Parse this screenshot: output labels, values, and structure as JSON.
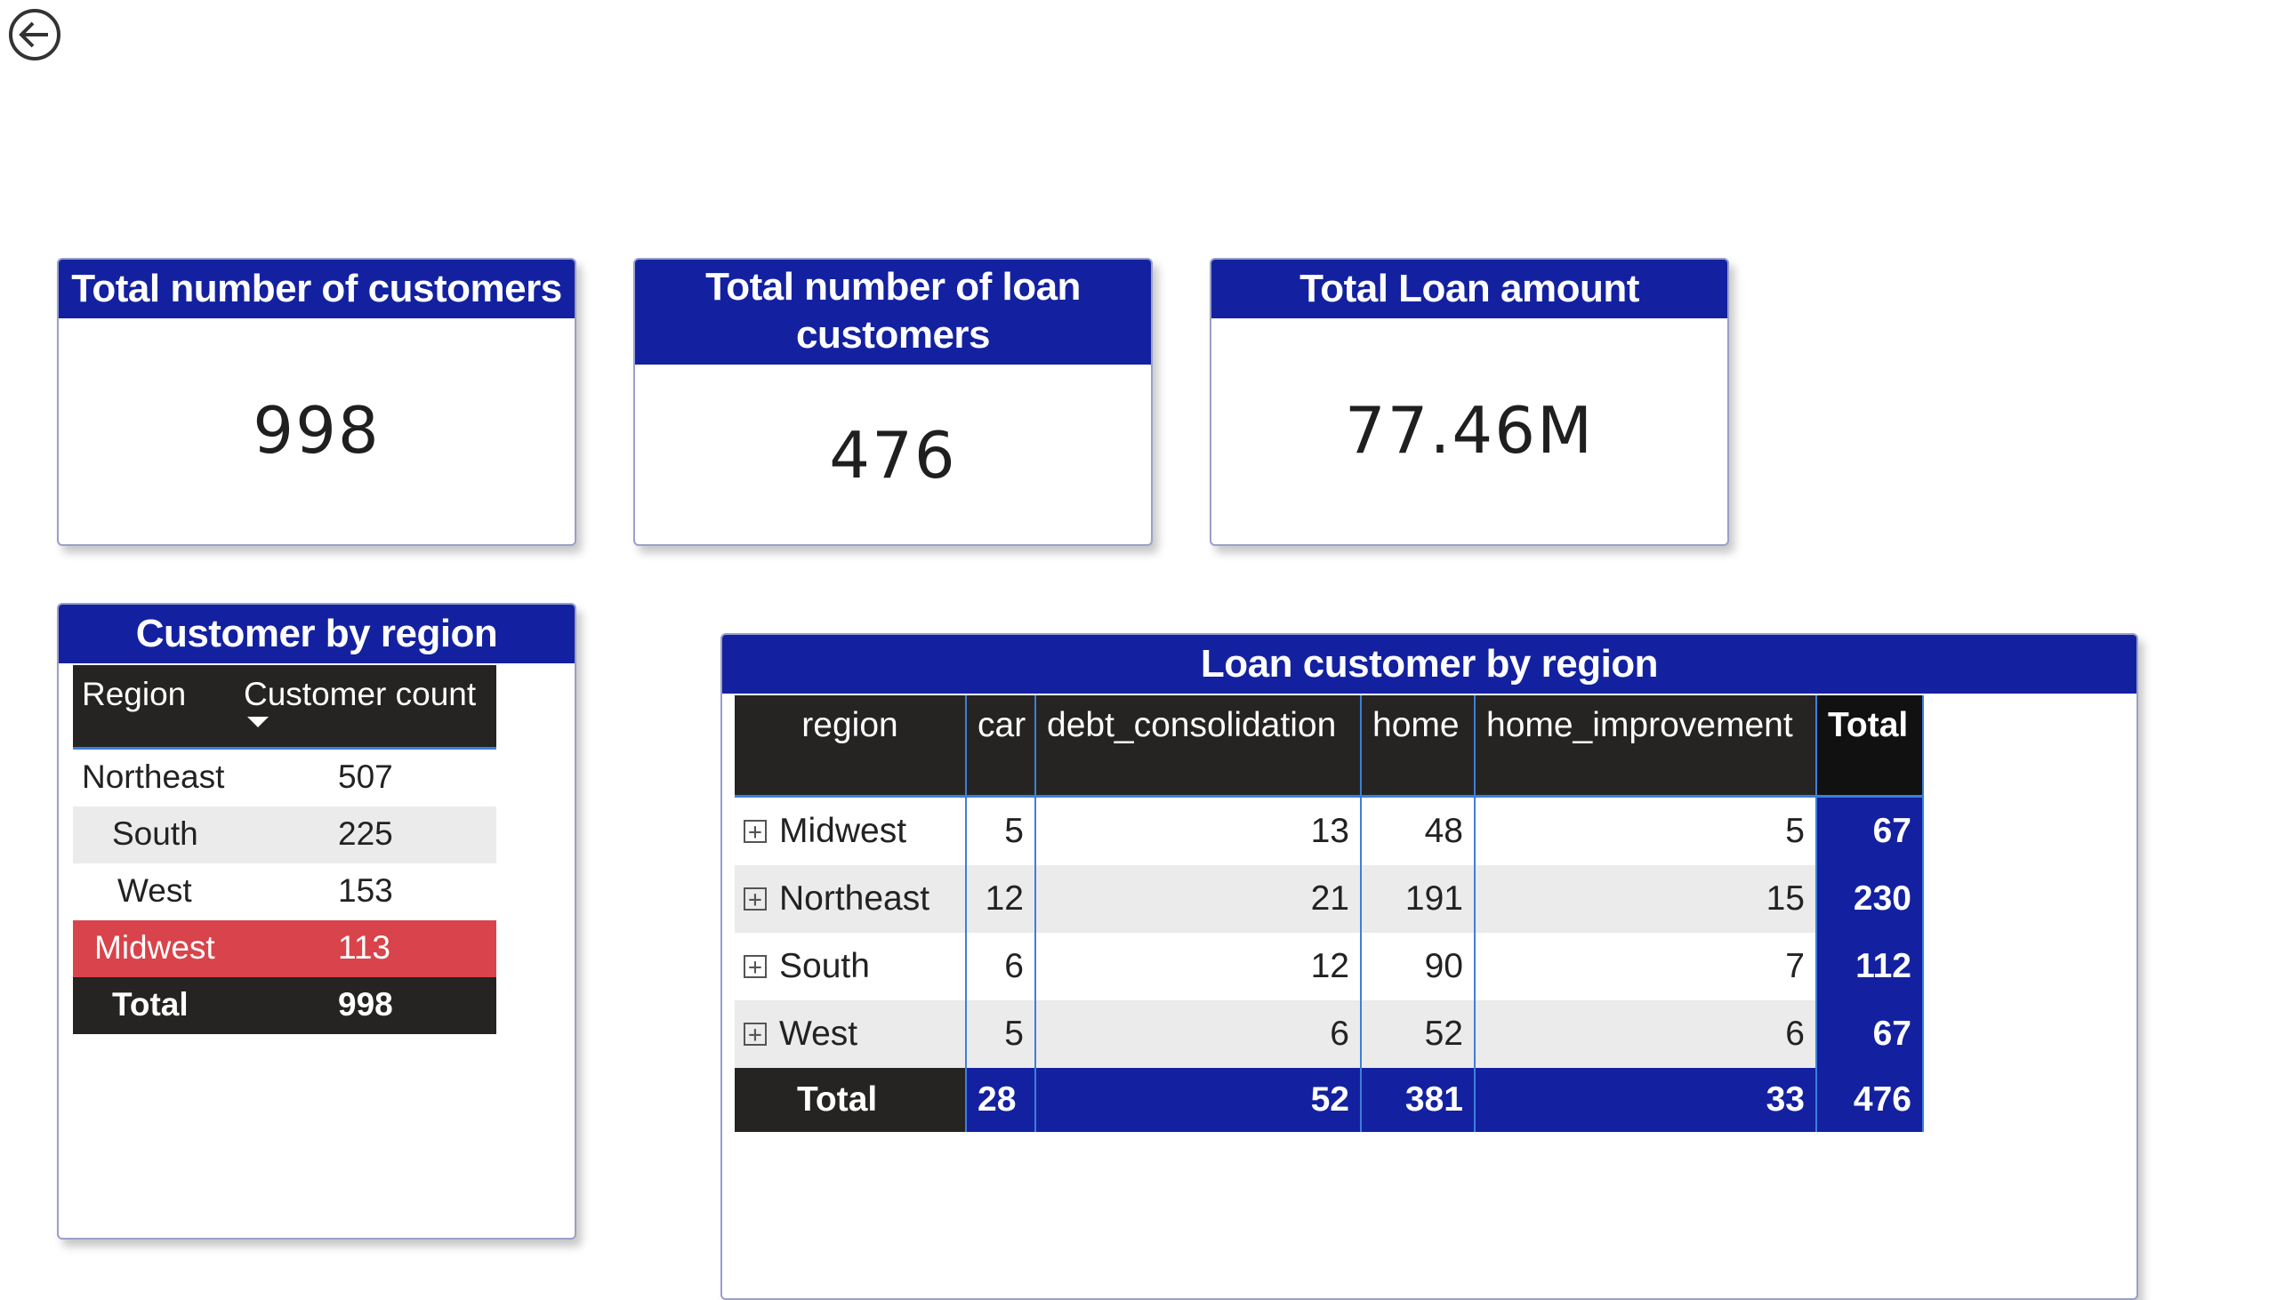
{
  "nav": {
    "back_icon": "back-arrow-icon"
  },
  "kpis": [
    {
      "title": "Total number of customers",
      "value": "998"
    },
    {
      "title": "Total number of loan customers",
      "value": "476"
    },
    {
      "title": "Total Loan amount",
      "value": "77.46M"
    }
  ],
  "customer_by_region": {
    "title": "Customer by region",
    "headers": {
      "region": "Region",
      "count": "Customer count"
    },
    "rows": [
      {
        "region": "Northeast",
        "count": "507"
      },
      {
        "region": "South",
        "count": "225"
      },
      {
        "region": "West",
        "count": "153"
      },
      {
        "region": "Midwest",
        "count": "113"
      }
    ],
    "total": {
      "label": "Total",
      "count": "998"
    },
    "highlight_color": "#d9434b"
  },
  "loan_by_region": {
    "title": "Loan customer by region",
    "headers": [
      "region",
      "car",
      "debt_consolidation",
      "home",
      "home_improvement",
      "Total"
    ],
    "rows": [
      {
        "region": "Midwest",
        "car": "5",
        "debt": "13",
        "home": "48",
        "home_imp": "5",
        "total": "67"
      },
      {
        "region": "Northeast",
        "car": "12",
        "debt": "21",
        "home": "191",
        "home_imp": "15",
        "total": "230"
      },
      {
        "region": "South",
        "car": "6",
        "debt": "12",
        "home": "90",
        "home_imp": "7",
        "total": "112"
      },
      {
        "region": "West",
        "car": "5",
        "debt": "6",
        "home": "52",
        "home_imp": "6",
        "total": "67"
      }
    ],
    "total": {
      "label": "Total",
      "car": "28",
      "debt": "52",
      "home": "381",
      "home_imp": "33",
      "total": "476"
    }
  },
  "colors": {
    "header_blue": "#1321a0",
    "dark": "#252423",
    "accent_line": "#3d7fd9"
  }
}
